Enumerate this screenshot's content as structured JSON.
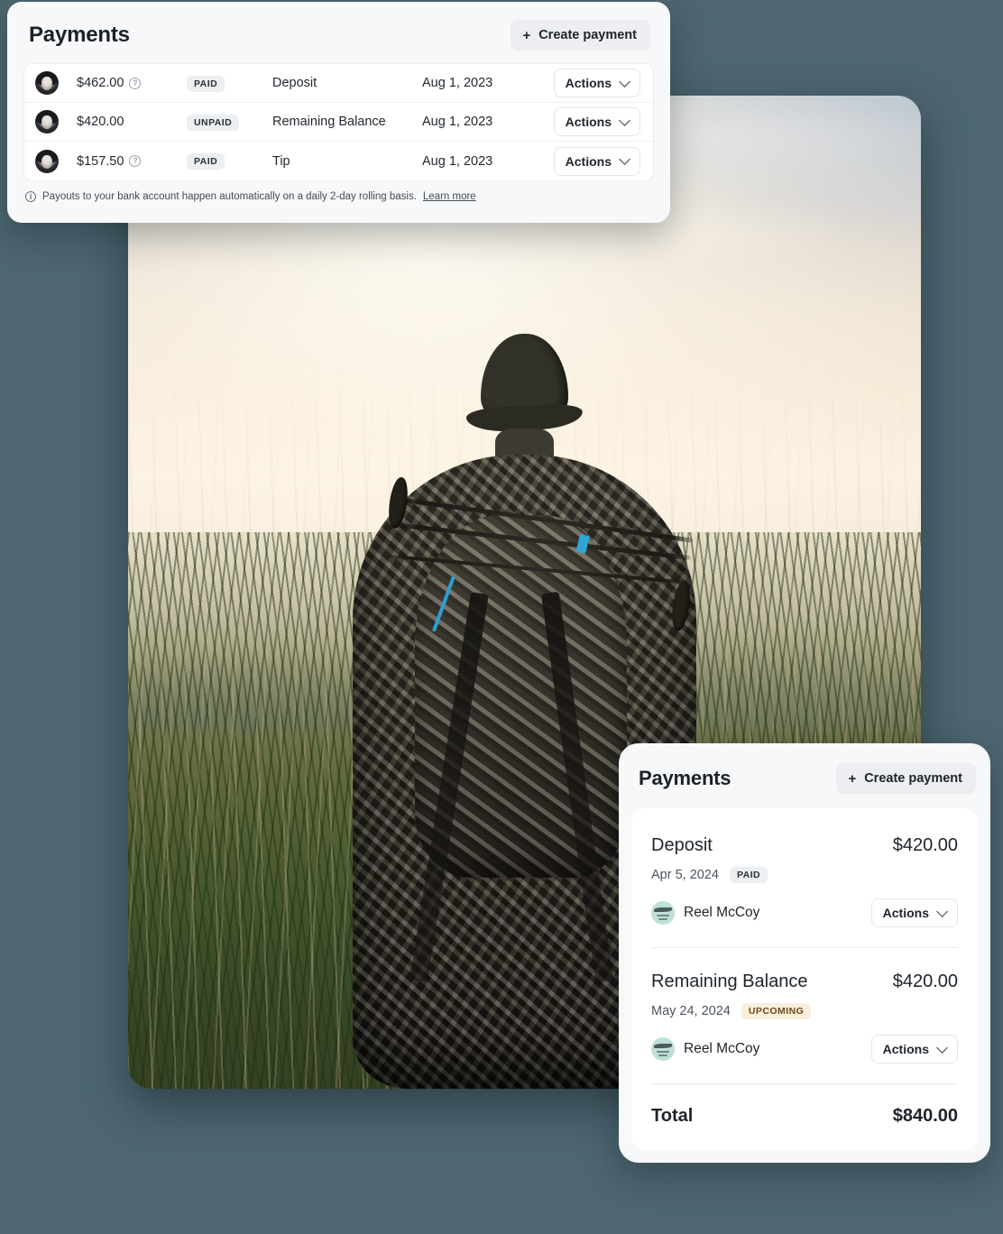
{
  "background_color": "#4d6670",
  "photo": {
    "alt_description": "Hunter in camouflage carrying a compound bow across the shoulders, walking through tall golden grass at sunset"
  },
  "top_card": {
    "title": "Payments",
    "create_button": {
      "label": "Create payment",
      "icon": "plus-icon"
    },
    "rows": [
      {
        "avatar": "customer-avatar",
        "amount": "$462.00",
        "has_info": true,
        "status": "PAID",
        "status_kind": "paid",
        "description": "Deposit",
        "date": "Aug 1, 2023",
        "actions_label": "Actions"
      },
      {
        "avatar": "customer-avatar",
        "amount": "$420.00",
        "has_info": false,
        "status": "UNPAID",
        "status_kind": "unpaid",
        "description": "Remaining Balance",
        "date": "Aug 1, 2023",
        "actions_label": "Actions"
      },
      {
        "avatar": "customer-avatar",
        "amount": "$157.50",
        "has_info": true,
        "status": "PAID",
        "status_kind": "paid",
        "description": "Tip",
        "date": "Aug 1, 2023",
        "actions_label": "Actions"
      }
    ],
    "footer_note": {
      "icon": "info-icon",
      "text": "Payouts to your bank account happen automatically on a daily 2-day rolling basis.",
      "link_label": "Learn more"
    }
  },
  "bottom_card": {
    "title": "Payments",
    "create_button": {
      "label": "Create payment",
      "icon": "plus-icon"
    },
    "items": [
      {
        "name": "Deposit",
        "amount": "$420.00",
        "date": "Apr 5, 2024",
        "status": "PAID",
        "status_kind": "paid",
        "vendor": "Reel McCoy",
        "actions_label": "Actions"
      },
      {
        "name": "Remaining Balance",
        "amount": "$420.00",
        "date": "May 24, 2024",
        "status": "UPCOMING",
        "status_kind": "upcoming",
        "vendor": "Reel McCoy",
        "actions_label": "Actions"
      }
    ],
    "total": {
      "label": "Total",
      "value": "$840.00"
    }
  },
  "colors": {
    "page_background": "#4d6670",
    "card_background": "#f7f8f9",
    "panel_white": "#ffffff",
    "text_primary": "#1d242b",
    "text_secondary": "#4c545d",
    "badge_neutral_bg": "#eceff2",
    "badge_upcoming_bg": "#fbeedb",
    "badge_upcoming_text": "#6b4a1d"
  }
}
